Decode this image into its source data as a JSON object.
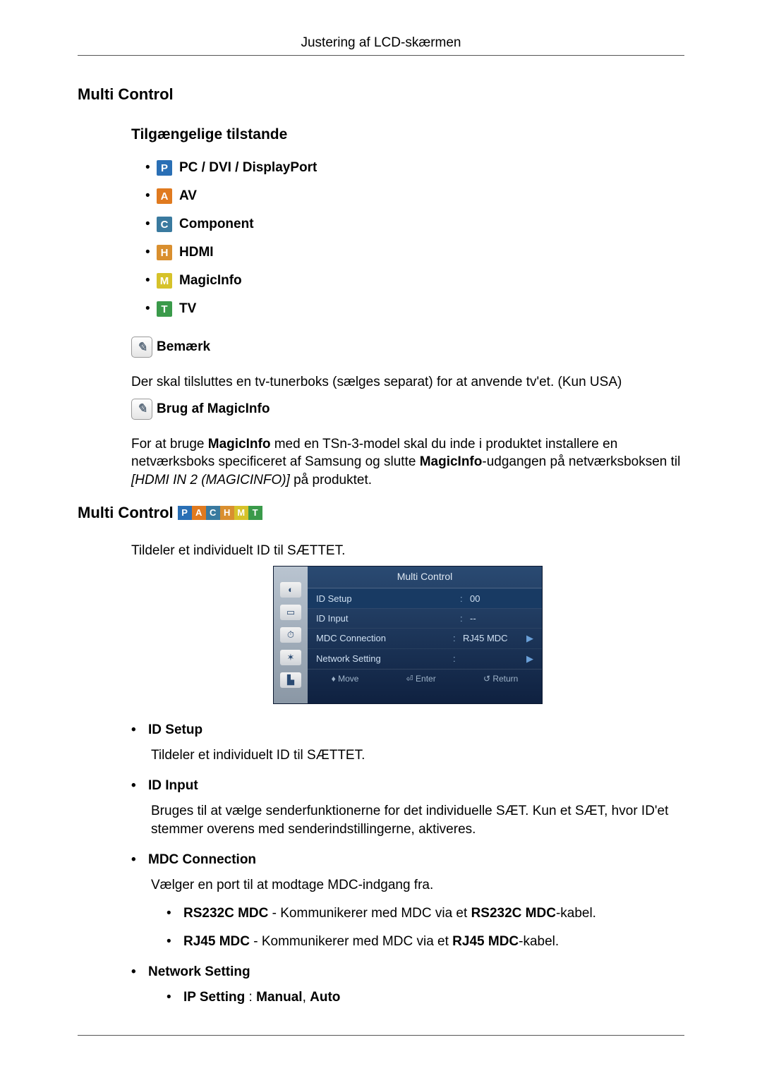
{
  "header": {
    "title": "Justering af LCD-skærmen"
  },
  "section1": {
    "title": "Multi Control",
    "modes_title": "Tilgængelige tilstande",
    "modes": [
      {
        "letter": "P",
        "color": "#2a6fb5",
        "label": "PC / DVI / DisplayPort"
      },
      {
        "letter": "A",
        "color": "#e07a1f",
        "label": "AV"
      },
      {
        "letter": "C",
        "color": "#3a7a9f",
        "label": "Component"
      },
      {
        "letter": "H",
        "color": "#d98f2f",
        "label": "HDMI"
      },
      {
        "letter": "M",
        "color": "#d6c22a",
        "label": "MagicInfo"
      },
      {
        "letter": "T",
        "color": "#3a9a4a",
        "label": "TV"
      }
    ],
    "note_label": "Bemærk",
    "note_body": "Der skal tilsluttes en tv-tunerboks (sælges separat) for at anvende tv'et. (Kun USA)",
    "magic_label": "Brug af MagicInfo",
    "magic_body_pre": "For at bruge ",
    "magic_body_bold1": "MagicInfo",
    "magic_body_mid": " med en TSn-3-model skal du inde i produktet installere en netværksboks specificeret af Samsung og slutte ",
    "magic_body_bold2": "MagicInfo",
    "magic_body_mid2": "-udgangen på netværksboksen til ",
    "magic_body_ital": "[HDMI IN 2 (MAGICINFO)]",
    "magic_body_post": " på produktet."
  },
  "section2": {
    "title": "Multi Control",
    "mini_modes": [
      {
        "letter": "P",
        "color": "#2a6fb5"
      },
      {
        "letter": "A",
        "color": "#e07a1f"
      },
      {
        "letter": "C",
        "color": "#3a7a9f"
      },
      {
        "letter": "H",
        "color": "#d98f2f"
      },
      {
        "letter": "M",
        "color": "#d6c22a"
      },
      {
        "letter": "T",
        "color": "#3a9a4a"
      }
    ],
    "intro": "Tildeler et individuelt ID til SÆTTET.",
    "osd": {
      "title": "Multi Control",
      "rows": [
        {
          "label": "ID Setup",
          "value": "00",
          "arrow": ""
        },
        {
          "label": "ID Input",
          "value": "--",
          "arrow": ""
        },
        {
          "label": "MDC Connection",
          "value": "RJ45 MDC",
          "arrow": "▶"
        },
        {
          "label": "Network Setting",
          "value": "",
          "arrow": "▶"
        }
      ],
      "foot": {
        "move": "Move",
        "enter": "Enter",
        "return": "Return"
      }
    },
    "items": [
      {
        "term": "ID Setup",
        "body": "Tildeler et individuelt ID til SÆTTET."
      },
      {
        "term": "ID Input",
        "body": "Bruges til at vælge senderfunktionerne for det individuelle SÆT. Kun et SÆT, hvor ID'et stemmer overens med senderindstillingerne, aktiveres."
      },
      {
        "term": "MDC Connection",
        "body": "Vælger en port til at modtage MDC-indgang fra.",
        "subs": [
          {
            "b1": "RS232C MDC",
            "mid": " - Kommunikerer med MDC via et ",
            "b2": "RS232C MDC",
            "post": "-kabel."
          },
          {
            "b1": "RJ45 MDC",
            "mid": " - Kommunikerer med MDC via et ",
            "b2": "RJ45 MDC",
            "post": "-kabel."
          }
        ]
      },
      {
        "term": "Network Setting",
        "subs2": [
          {
            "b1": "IP Setting",
            "mid": " : ",
            "b2": "Manual",
            "sep": ", ",
            "b3": "Auto"
          }
        ]
      }
    ]
  }
}
